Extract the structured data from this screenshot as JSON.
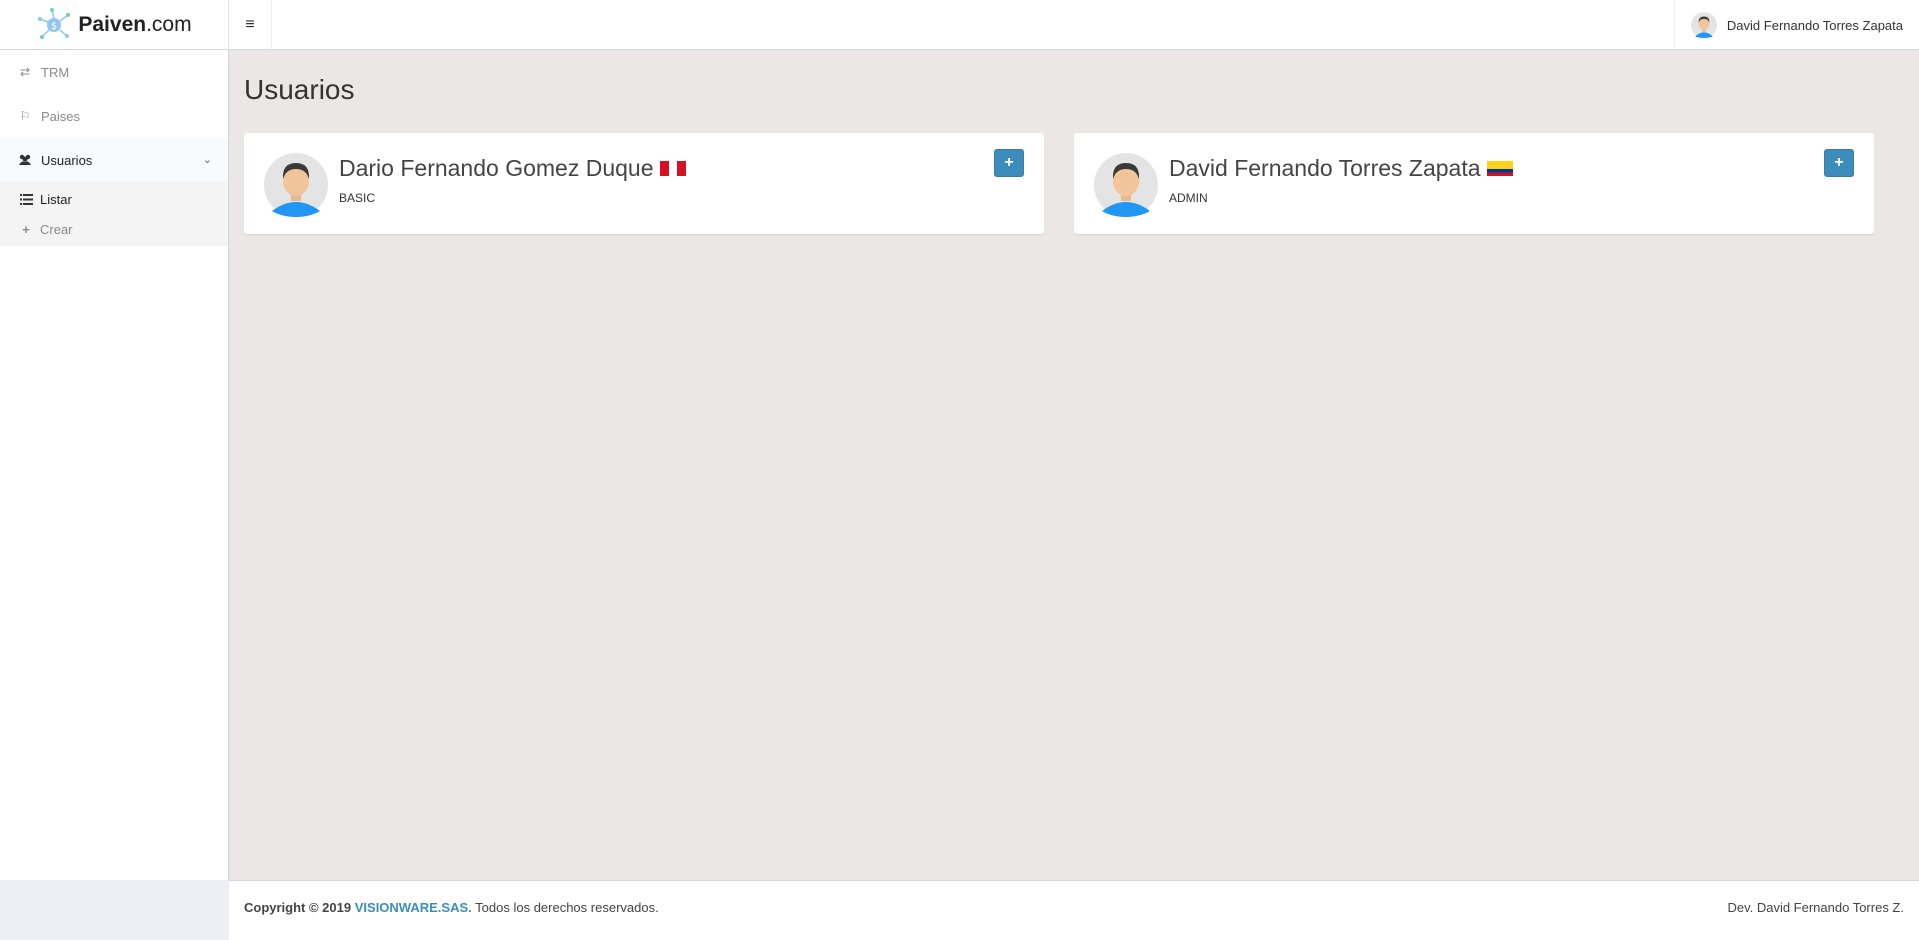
{
  "brand": {
    "name_bold": "Paiven",
    "name_light": ".com"
  },
  "header": {
    "toggle_icon": "hamburger-icon",
    "user_name": "David Fernando Torres Zapata"
  },
  "sidebar": {
    "items": [
      {
        "label": "TRM",
        "icon": "exchange-icon"
      },
      {
        "label": "Paises",
        "icon": "flag-icon"
      },
      {
        "label": "Usuarios",
        "icon": "users-icon",
        "expanded": true,
        "children": [
          {
            "label": "Listar",
            "icon": "list-icon"
          },
          {
            "label": "Crear",
            "icon": "plus-icon"
          }
        ]
      }
    ]
  },
  "main": {
    "title": "Usuarios",
    "users": [
      {
        "name": "Dario Fernando Gomez Duque",
        "role": "BASIC",
        "flag": "peru-flag",
        "action": "+"
      },
      {
        "name": "David Fernando Torres Zapata",
        "role": "ADMIN",
        "flag": "colombia-flag",
        "action": "+"
      }
    ]
  },
  "footer": {
    "copyright": "Copyright © 2019",
    "company": "VISIONWARE.SAS.",
    "rights": "Todos los derechos reservados.",
    "dev": "Dev. David Fernando Torres Z."
  },
  "colors": {
    "primary": "#3c8dbc",
    "content_bg": "#ebe7e6",
    "avatar_shirt": "#2196f3"
  }
}
